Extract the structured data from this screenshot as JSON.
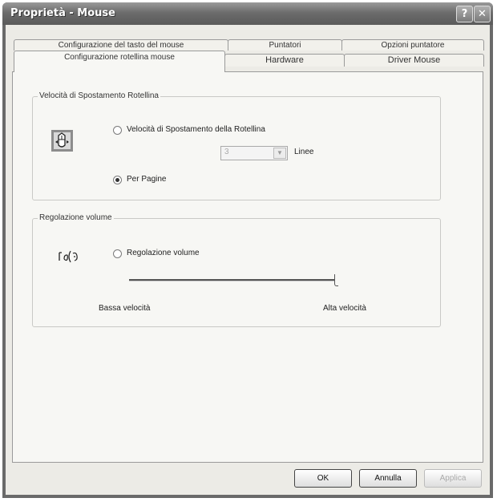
{
  "window": {
    "title": "Proprietà - Mouse",
    "help_glyph": "?",
    "close_glyph": "✕"
  },
  "tabs": {
    "row1": [
      "Configurazione del tasto del mouse",
      "Puntatori",
      "Opzioni puntatore"
    ],
    "row2": [
      "Configurazione rotellina mouse",
      "Hardware",
      "Driver Mouse"
    ],
    "active": "Configurazione rotellina mouse"
  },
  "wheel_group": {
    "legend": "Velocità di Spostamento Rotellina",
    "option_speed": "Velocità di Spostamento della Rotellina",
    "lines_value": "3",
    "lines_unit": "Linee",
    "option_pages": "Per Pagine",
    "selected": "Per Pagine",
    "icon": "mouse-wheel-icon"
  },
  "volume_group": {
    "legend": "Regolazione volume",
    "option_volume": "Regolazione volume",
    "low_label": "Bassa velocità",
    "high_label": "Alta velocità",
    "icon": "volume-adjust-icon",
    "slider_level": 1.0
  },
  "footer": {
    "ok": "OK",
    "cancel": "Annulla",
    "apply": "Applica"
  }
}
